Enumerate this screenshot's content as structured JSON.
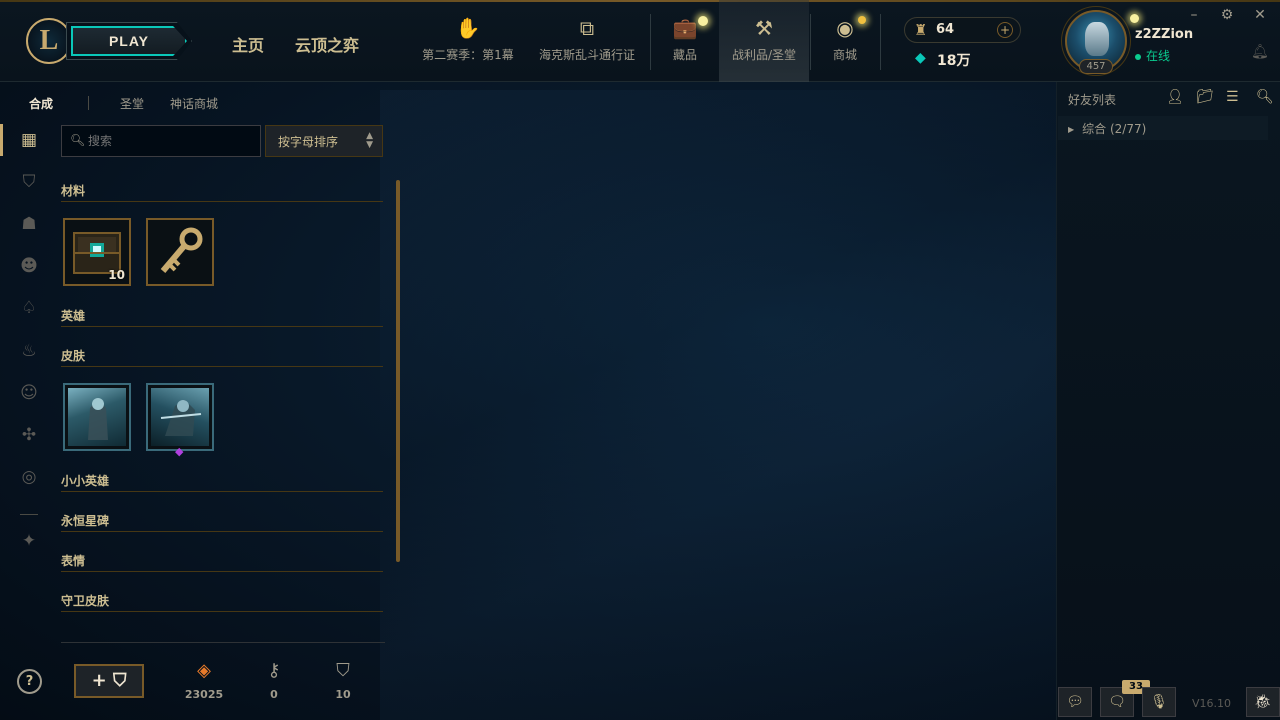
{
  "topbar": {
    "logo_letter": "L",
    "play_label": "PLAY",
    "nav_home": "主页",
    "nav_tft": "云顶之弈",
    "icon_items": [
      {
        "label": "第二赛季：第1幕",
        "icon": "pass-icon"
      },
      {
        "label": "海克斯乱斗通行证",
        "icon": "event-pass-icon"
      },
      {
        "label": "藏品",
        "icon": "collection-icon"
      },
      {
        "label": "战利品/圣堂",
        "icon": "loot-icon"
      },
      {
        "label": "商城",
        "icon": "store-icon"
      }
    ],
    "rp_amount": "64",
    "be_amount": "18万",
    "plus_label": "+",
    "level": "457",
    "username": "z2ZZion",
    "status": "在线",
    "accent_gold": "#c8aa6e",
    "accent_teal": "#0ac8b9",
    "online_green": "#0acb8e"
  },
  "subnav": {
    "craft": "合成",
    "sanctum": "圣堂",
    "mythic_shop": "神话商城"
  },
  "search": {
    "placeholder": "搜索"
  },
  "sort": {
    "label": "按字母排序"
  },
  "sections": {
    "materials": "材料",
    "champions": "英雄",
    "skins": "皮肤",
    "little_legends": "小小英雄",
    "eternals": "永恒星碑",
    "emotes": "表情",
    "ward_skins": "守卫皮肤"
  },
  "materials": [
    {
      "name": "hextech-chest",
      "count": "10"
    },
    {
      "name": "hextech-key",
      "count": ""
    }
  ],
  "skins": [
    {
      "name": "skin-shard-1"
    },
    {
      "name": "skin-shard-2"
    }
  ],
  "footer": {
    "help": "?",
    "add_chest": "+",
    "orange_essence": "23025",
    "keys": "0",
    "chests": "10"
  },
  "friends": {
    "title": "好友列表",
    "group": "综合 (2/77)"
  },
  "bottom_bar": {
    "badge": "33",
    "version": "V16.10"
  }
}
